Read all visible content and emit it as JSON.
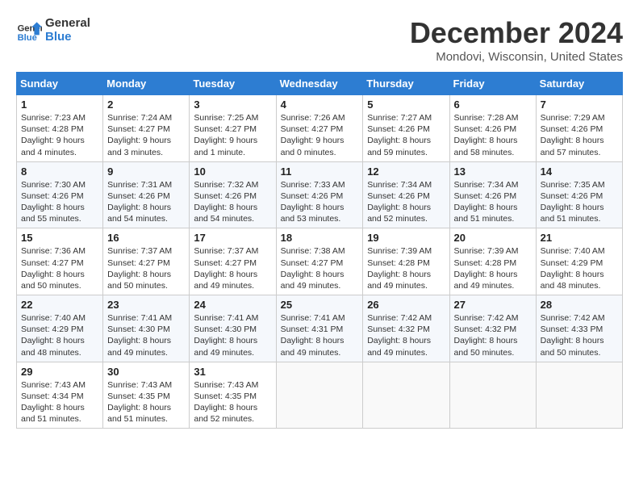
{
  "header": {
    "logo_line1": "General",
    "logo_line2": "Blue",
    "month_title": "December 2024",
    "location": "Mondovi, Wisconsin, United States"
  },
  "weekdays": [
    "Sunday",
    "Monday",
    "Tuesday",
    "Wednesday",
    "Thursday",
    "Friday",
    "Saturday"
  ],
  "weeks": [
    [
      {
        "day": "1",
        "sunrise": "Sunrise: 7:23 AM",
        "sunset": "Sunset: 4:28 PM",
        "daylight": "Daylight: 9 hours and 4 minutes."
      },
      {
        "day": "2",
        "sunrise": "Sunrise: 7:24 AM",
        "sunset": "Sunset: 4:27 PM",
        "daylight": "Daylight: 9 hours and 3 minutes."
      },
      {
        "day": "3",
        "sunrise": "Sunrise: 7:25 AM",
        "sunset": "Sunset: 4:27 PM",
        "daylight": "Daylight: 9 hours and 1 minute."
      },
      {
        "day": "4",
        "sunrise": "Sunrise: 7:26 AM",
        "sunset": "Sunset: 4:27 PM",
        "daylight": "Daylight: 9 hours and 0 minutes."
      },
      {
        "day": "5",
        "sunrise": "Sunrise: 7:27 AM",
        "sunset": "Sunset: 4:26 PM",
        "daylight": "Daylight: 8 hours and 59 minutes."
      },
      {
        "day": "6",
        "sunrise": "Sunrise: 7:28 AM",
        "sunset": "Sunset: 4:26 PM",
        "daylight": "Daylight: 8 hours and 58 minutes."
      },
      {
        "day": "7",
        "sunrise": "Sunrise: 7:29 AM",
        "sunset": "Sunset: 4:26 PM",
        "daylight": "Daylight: 8 hours and 57 minutes."
      }
    ],
    [
      {
        "day": "8",
        "sunrise": "Sunrise: 7:30 AM",
        "sunset": "Sunset: 4:26 PM",
        "daylight": "Daylight: 8 hours and 55 minutes."
      },
      {
        "day": "9",
        "sunrise": "Sunrise: 7:31 AM",
        "sunset": "Sunset: 4:26 PM",
        "daylight": "Daylight: 8 hours and 54 minutes."
      },
      {
        "day": "10",
        "sunrise": "Sunrise: 7:32 AM",
        "sunset": "Sunset: 4:26 PM",
        "daylight": "Daylight: 8 hours and 54 minutes."
      },
      {
        "day": "11",
        "sunrise": "Sunrise: 7:33 AM",
        "sunset": "Sunset: 4:26 PM",
        "daylight": "Daylight: 8 hours and 53 minutes."
      },
      {
        "day": "12",
        "sunrise": "Sunrise: 7:34 AM",
        "sunset": "Sunset: 4:26 PM",
        "daylight": "Daylight: 8 hours and 52 minutes."
      },
      {
        "day": "13",
        "sunrise": "Sunrise: 7:34 AM",
        "sunset": "Sunset: 4:26 PM",
        "daylight": "Daylight: 8 hours and 51 minutes."
      },
      {
        "day": "14",
        "sunrise": "Sunrise: 7:35 AM",
        "sunset": "Sunset: 4:26 PM",
        "daylight": "Daylight: 8 hours and 51 minutes."
      }
    ],
    [
      {
        "day": "15",
        "sunrise": "Sunrise: 7:36 AM",
        "sunset": "Sunset: 4:27 PM",
        "daylight": "Daylight: 8 hours and 50 minutes."
      },
      {
        "day": "16",
        "sunrise": "Sunrise: 7:37 AM",
        "sunset": "Sunset: 4:27 PM",
        "daylight": "Daylight: 8 hours and 50 minutes."
      },
      {
        "day": "17",
        "sunrise": "Sunrise: 7:37 AM",
        "sunset": "Sunset: 4:27 PM",
        "daylight": "Daylight: 8 hours and 49 minutes."
      },
      {
        "day": "18",
        "sunrise": "Sunrise: 7:38 AM",
        "sunset": "Sunset: 4:27 PM",
        "daylight": "Daylight: 8 hours and 49 minutes."
      },
      {
        "day": "19",
        "sunrise": "Sunrise: 7:39 AM",
        "sunset": "Sunset: 4:28 PM",
        "daylight": "Daylight: 8 hours and 49 minutes."
      },
      {
        "day": "20",
        "sunrise": "Sunrise: 7:39 AM",
        "sunset": "Sunset: 4:28 PM",
        "daylight": "Daylight: 8 hours and 49 minutes."
      },
      {
        "day": "21",
        "sunrise": "Sunrise: 7:40 AM",
        "sunset": "Sunset: 4:29 PM",
        "daylight": "Daylight: 8 hours and 48 minutes."
      }
    ],
    [
      {
        "day": "22",
        "sunrise": "Sunrise: 7:40 AM",
        "sunset": "Sunset: 4:29 PM",
        "daylight": "Daylight: 8 hours and 48 minutes."
      },
      {
        "day": "23",
        "sunrise": "Sunrise: 7:41 AM",
        "sunset": "Sunset: 4:30 PM",
        "daylight": "Daylight: 8 hours and 49 minutes."
      },
      {
        "day": "24",
        "sunrise": "Sunrise: 7:41 AM",
        "sunset": "Sunset: 4:30 PM",
        "daylight": "Daylight: 8 hours and 49 minutes."
      },
      {
        "day": "25",
        "sunrise": "Sunrise: 7:41 AM",
        "sunset": "Sunset: 4:31 PM",
        "daylight": "Daylight: 8 hours and 49 minutes."
      },
      {
        "day": "26",
        "sunrise": "Sunrise: 7:42 AM",
        "sunset": "Sunset: 4:32 PM",
        "daylight": "Daylight: 8 hours and 49 minutes."
      },
      {
        "day": "27",
        "sunrise": "Sunrise: 7:42 AM",
        "sunset": "Sunset: 4:32 PM",
        "daylight": "Daylight: 8 hours and 50 minutes."
      },
      {
        "day": "28",
        "sunrise": "Sunrise: 7:42 AM",
        "sunset": "Sunset: 4:33 PM",
        "daylight": "Daylight: 8 hours and 50 minutes."
      }
    ],
    [
      {
        "day": "29",
        "sunrise": "Sunrise: 7:43 AM",
        "sunset": "Sunset: 4:34 PM",
        "daylight": "Daylight: 8 hours and 51 minutes."
      },
      {
        "day": "30",
        "sunrise": "Sunrise: 7:43 AM",
        "sunset": "Sunset: 4:35 PM",
        "daylight": "Daylight: 8 hours and 51 minutes."
      },
      {
        "day": "31",
        "sunrise": "Sunrise: 7:43 AM",
        "sunset": "Sunset: 4:35 PM",
        "daylight": "Daylight: 8 hours and 52 minutes."
      },
      null,
      null,
      null,
      null
    ]
  ]
}
